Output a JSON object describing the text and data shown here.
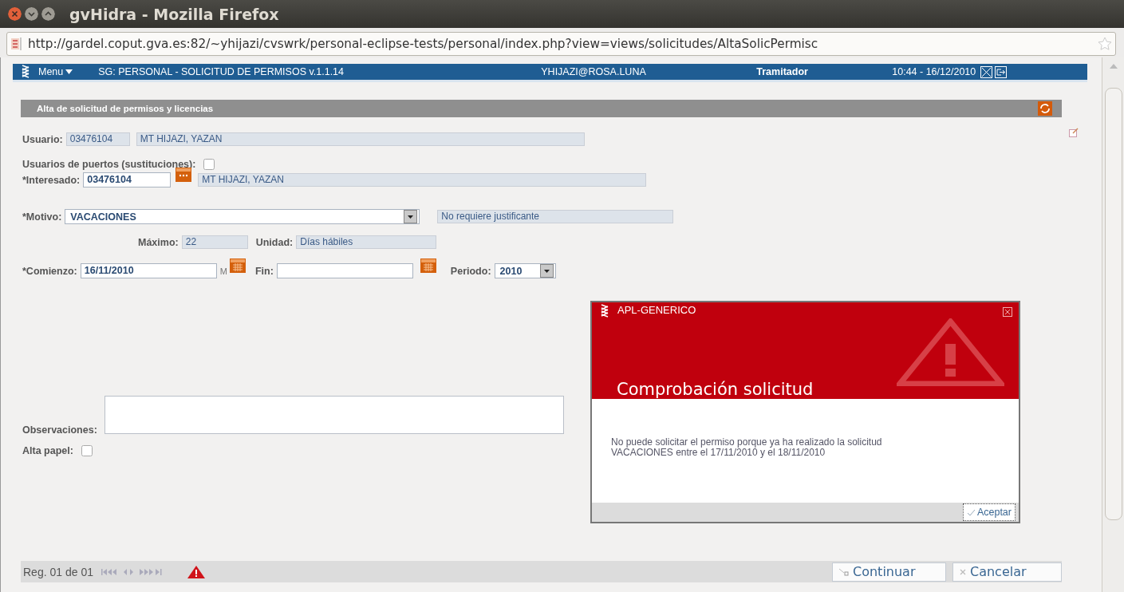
{
  "window": {
    "title": "gvHidra - Mozilla Firefox"
  },
  "address_bar": {
    "url": "http://gardel.coput.gva.es:82/~yhijazi/cvswrk/personal-eclipse-tests/personal/index.php?view=views/solicitudes/AltaSolicPermisc"
  },
  "app_header": {
    "menu": "Menu",
    "app_name": "SG: PERSONAL - SOLICITUD DE PERMISOS  v.1.1.14",
    "user": "YHIJAZI@ROSA.LUNA",
    "role": "Tramitador",
    "datetime": "10:44 - 16/12/2010"
  },
  "panel": {
    "title": "Alta de solicitud de permisos y licencias"
  },
  "form": {
    "usuario": {
      "label": "Usuario:",
      "code": "03476104",
      "name": "MT HIJAZI, YAZAN"
    },
    "usuarios_puertos": {
      "label": "Usuarios de puertos (sustituciones):",
      "checked": false
    },
    "interesado": {
      "label": "*Interesado:",
      "code": "03476104",
      "name": "MT HIJAZI, YAZAN"
    },
    "motivo": {
      "label": "*Motivo:",
      "value": "VACACIONES",
      "note": "No requiere justificante"
    },
    "maximo": {
      "label": "Máximo:",
      "value": "22"
    },
    "unidad": {
      "label": "Unidad:",
      "value": "Días hábiles"
    },
    "comienzo": {
      "label": "*Comienzo:",
      "value": "16/11/2010",
      "suffix": "M"
    },
    "fin": {
      "label": "Fin:"
    },
    "periodo": {
      "label": "Periodo:",
      "value": "2010"
    },
    "observaciones": {
      "label": "Observaciones:"
    },
    "alta_papel": {
      "label": "Alta papel:",
      "checked": false
    }
  },
  "dialog": {
    "app": "APL-GENERICO",
    "title": "Comprobación solicitud",
    "message": "No puede solicitar el permiso porque ya ha realizado la solicitud\nVACACIONES entre el 17/11/2010 y el 18/11/2010",
    "button": "Aceptar"
  },
  "footer": {
    "record": "Reg. 01 de 01",
    "buttons": [
      {
        "label": "Continuar",
        "kind": "continue"
      },
      {
        "label": "Cancelar",
        "kind": "cancel"
      }
    ]
  }
}
